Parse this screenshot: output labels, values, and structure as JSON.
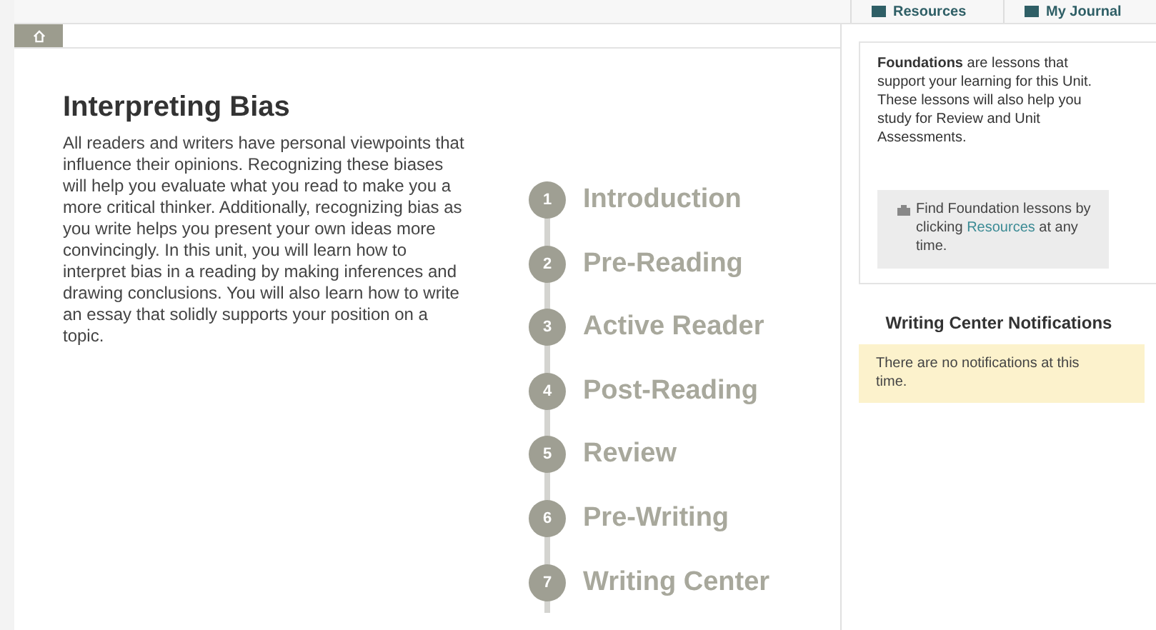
{
  "top_tabs": [
    {
      "label": "Resources"
    },
    {
      "label": "My Journal"
    }
  ],
  "lesson": {
    "title": "Interpreting Bias",
    "description": "All readers and writers have personal viewpoints that influence their opinions. Recognizing these biases will help you evaluate what you read to make you a more critical thinker. Additionally, recognizing bias as you write helps you present your own ideas more convincingly. In this unit, you will learn how to interpret bias in a reading by making inferences and drawing conclusions. You will also learn how to write an essay that solidly supports your position on a topic."
  },
  "steps": [
    {
      "number": "1",
      "label": "Introduction"
    },
    {
      "number": "2",
      "label": "Pre-Reading"
    },
    {
      "number": "3",
      "label": "Active Reader"
    },
    {
      "number": "4",
      "label": "Post-Reading"
    },
    {
      "number": "5",
      "label": "Review"
    },
    {
      "number": "6",
      "label": "Pre-Writing"
    },
    {
      "number": "7",
      "label": "Writing Center"
    }
  ],
  "foundations": {
    "text": "**Foundations** are lessons that support your learning for this Unit. These lessons will also help you study for Review and Unit Assessments.",
    "tip_before": "Find Foundation lessons by clicking",
    "tip_link": "Resources",
    "tip_after": "at any time."
  },
  "notifications": {
    "title": "Writing Center Notifications",
    "message": "There are no notifications at this time."
  }
}
